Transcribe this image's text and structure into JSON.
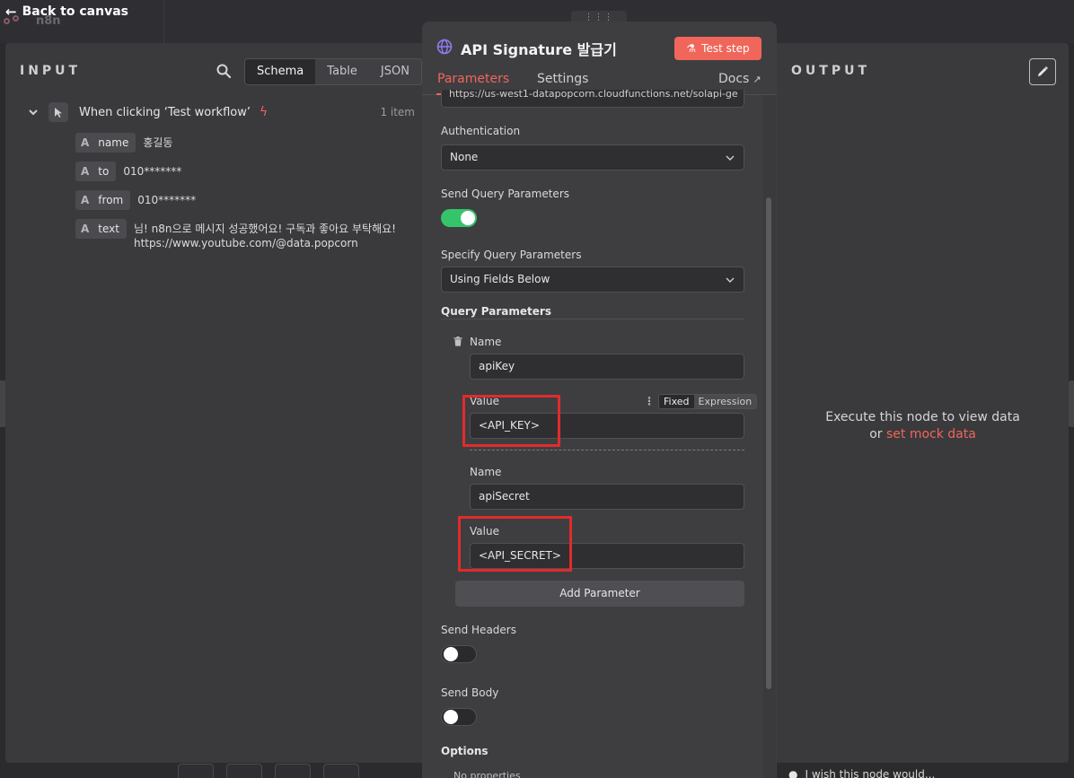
{
  "topbar": {
    "back_label": "Back to canvas",
    "logo_text": "n8n"
  },
  "input": {
    "title": "INPUT",
    "view_tabs": [
      "Schema",
      "Table",
      "JSON"
    ],
    "trigger": {
      "label": "When clicking ‘Test workflow’",
      "count": "1 item"
    },
    "fields": [
      {
        "type": "A",
        "key": "name",
        "value": "홍길동"
      },
      {
        "type": "A",
        "key": "to",
        "value": "010*******"
      },
      {
        "type": "A",
        "key": "from",
        "value": "010*******"
      },
      {
        "type": "A",
        "key": "text",
        "value_line1": "님! n8n으로 메시지 성공했어요! 구독과 좋아요 부탁해요!",
        "value_line2": "https://www.youtube.com/@data.popcorn"
      }
    ]
  },
  "node": {
    "title": "API Signature 발급기",
    "test_button": "Test step",
    "tabs": {
      "parameters": "Parameters",
      "settings": "Settings",
      "docs": "Docs"
    },
    "url_value": "https://us-west1-datapopcorn.cloudfunctions.net/solapi-ge",
    "authentication": {
      "label": "Authentication",
      "value": "None"
    },
    "send_query": {
      "label": "Send Query Parameters",
      "enabled": true
    },
    "specify_query": {
      "label": "Specify Query Parameters",
      "value": "Using Fields Below"
    },
    "query_params": {
      "heading": "Query Parameters",
      "items": [
        {
          "name_label": "Name",
          "name": "apiKey",
          "value_label": "Value",
          "value": "<API_KEY>"
        },
        {
          "name_label": "Name",
          "name": "apiSecret",
          "value_label": "Value",
          "value": "<API_SECRET>"
        }
      ],
      "mode_fixed": "Fixed",
      "mode_expression": "Expression",
      "add_button": "Add Parameter"
    },
    "send_headers": {
      "label": "Send Headers",
      "enabled": false
    },
    "send_body": {
      "label": "Send Body",
      "enabled": false
    },
    "options": {
      "heading": "Options",
      "sub": "No properties"
    }
  },
  "output": {
    "title": "OUTPUT",
    "empty_line1": "Execute this node to view data",
    "empty_or": "or",
    "empty_link": "set mock data",
    "wish": "I wish this node would..."
  },
  "colors": {
    "accent": "#f0665a",
    "toggle_on": "#36c46a",
    "highlight": "#e22b2b"
  }
}
